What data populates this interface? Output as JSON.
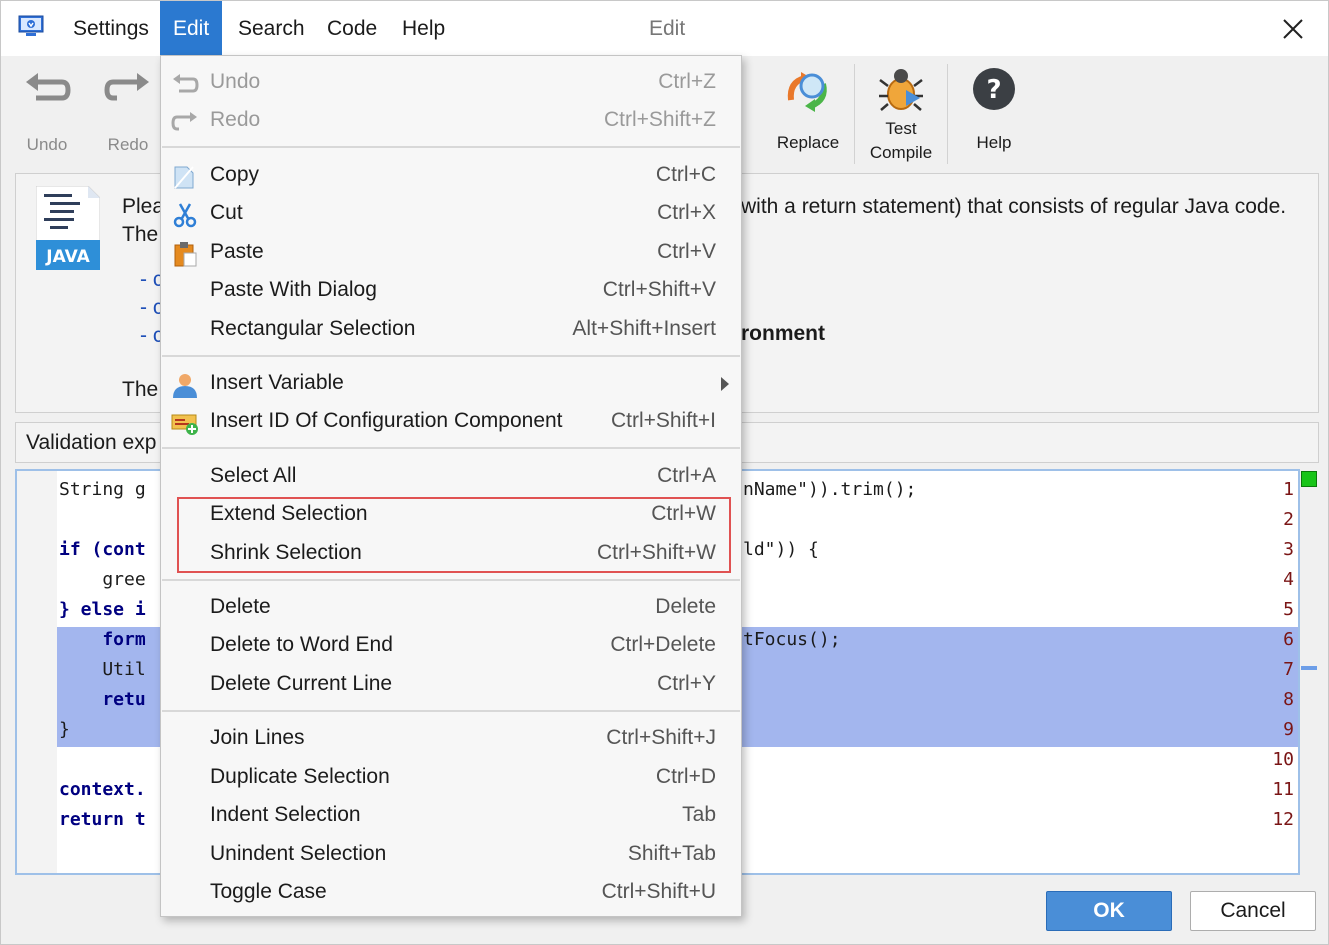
{
  "window": {
    "title": "Edit"
  },
  "menubar": [
    {
      "label": "Settings"
    },
    {
      "label": "Edit",
      "active": true
    },
    {
      "label": "Search"
    },
    {
      "label": "Code"
    },
    {
      "label": "Help"
    }
  ],
  "toolbar": {
    "undo": "Undo",
    "redo": "Redo",
    "replace": "Replace",
    "test_compile_line1": "Test",
    "test_compile_line2": "Compile",
    "help": "Help"
  },
  "description": {
    "line1_start": "Plea",
    "line1_end": "with a return statement) that consists of regular Java code.",
    "line2_start": "The",
    "links": [
      "- c",
      "- c",
      "- c"
    ],
    "bold_fragment": "ronment",
    "line3_start": "The",
    "java_badge": "JAVA"
  },
  "validation": {
    "label": "Validation exp"
  },
  "editor": {
    "lines": [
      {
        "n": "1",
        "left": "String g",
        "right": "nName\")).trim();"
      },
      {
        "n": "2",
        "left": "",
        "right": ""
      },
      {
        "n": "3",
        "left": "if (cont",
        "right": "ld\")) {"
      },
      {
        "n": "4",
        "left": "    gree",
        "right": ""
      },
      {
        "n": "5",
        "left": "} else i",
        "right": ""
      },
      {
        "n": "6",
        "left": "    form",
        "right": "tFocus();"
      },
      {
        "n": "7",
        "left": "    Util",
        "right": ""
      },
      {
        "n": "8",
        "left": "    retu",
        "right": ""
      },
      {
        "n": "9",
        "left": "}",
        "right": ""
      },
      {
        "n": "10",
        "left": "",
        "right": ""
      },
      {
        "n": "11",
        "left": "context.",
        "right": ""
      },
      {
        "n": "12",
        "left": "return t",
        "right": ""
      }
    ]
  },
  "buttons": {
    "ok": "OK",
    "cancel": "Cancel"
  },
  "edit_menu": {
    "items": [
      {
        "label": "Undo",
        "shortcut": "Ctrl+Z",
        "icon": "undo-icon",
        "disabled": true
      },
      {
        "label": "Redo",
        "shortcut": "Ctrl+Shift+Z",
        "icon": "redo-icon",
        "disabled": true
      },
      {
        "label": "Copy",
        "shortcut": "Ctrl+C",
        "icon": "copy-icon"
      },
      {
        "label": "Cut",
        "shortcut": "Ctrl+X",
        "icon": "scissors-icon"
      },
      {
        "label": "Paste",
        "shortcut": "Ctrl+V",
        "icon": "clipboard-icon"
      },
      {
        "label": "Paste With Dialog",
        "shortcut": "Ctrl+Shift+V"
      },
      {
        "label": "Rectangular Selection",
        "shortcut": "Alt+Shift+Insert"
      },
      {
        "label": "Insert Variable",
        "shortcut": "",
        "icon": "user-icon",
        "submenu": true
      },
      {
        "label": "Insert ID Of Configuration Component",
        "shortcut": "Ctrl+Shift+I",
        "icon": "add-component-icon"
      },
      {
        "label": "Select All",
        "shortcut": "Ctrl+A"
      },
      {
        "label": "Extend Selection",
        "shortcut": "Ctrl+W"
      },
      {
        "label": "Shrink Selection",
        "shortcut": "Ctrl+Shift+W"
      },
      {
        "label": "Delete",
        "shortcut": "Delete"
      },
      {
        "label": "Delete to Word End",
        "shortcut": "Ctrl+Delete"
      },
      {
        "label": "Delete Current Line",
        "shortcut": "Ctrl+Y"
      },
      {
        "label": "Join Lines",
        "shortcut": "Ctrl+Shift+J"
      },
      {
        "label": "Duplicate Selection",
        "shortcut": "Ctrl+D"
      },
      {
        "label": "Indent Selection",
        "shortcut": "Tab"
      },
      {
        "label": "Unindent Selection",
        "shortcut": "Shift+Tab"
      },
      {
        "label": "Toggle Case",
        "shortcut": "Ctrl+Shift+U"
      }
    ]
  },
  "colors": {
    "accent": "#2b79d0",
    "selection": "#a3b6ee",
    "highlight_border": "#e05252",
    "ok_button": "#4a8ed7"
  }
}
